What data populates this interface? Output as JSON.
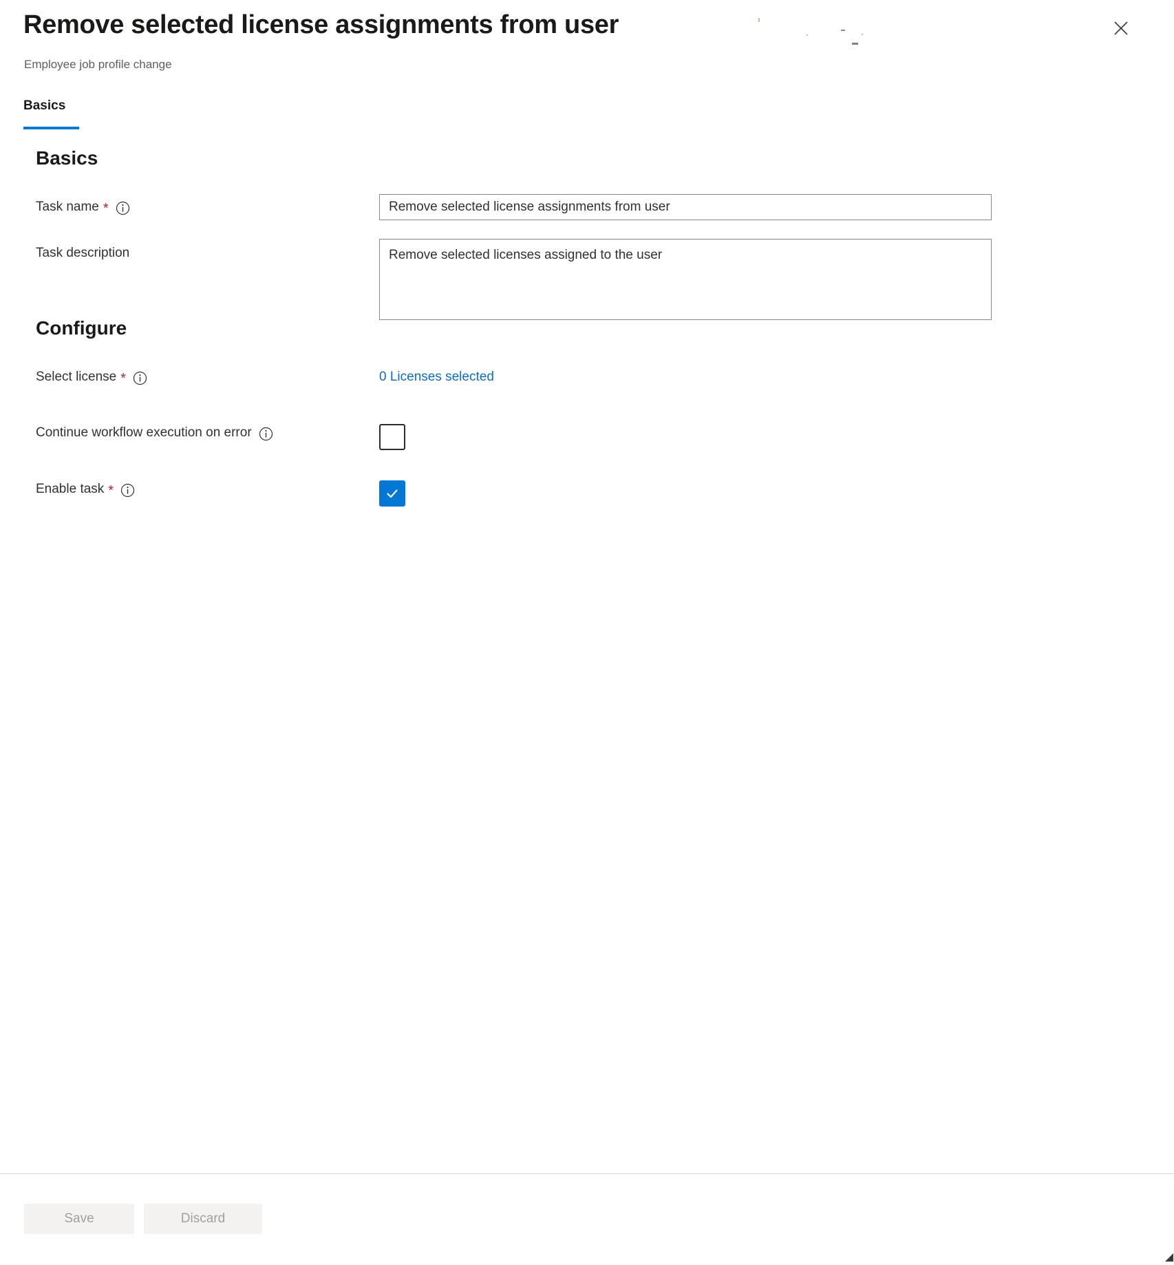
{
  "blade": {
    "title": "Remove selected license assignments from user",
    "subtitle": "Employee job profile change",
    "close_label": "Close",
    "close_icon": "close-icon"
  },
  "tabs": [
    {
      "label": "Basics",
      "selected": true
    }
  ],
  "sections": [
    {
      "heading": "Basics",
      "fields": [
        {
          "label": "Task name",
          "required": true,
          "info_icon": "info-icon",
          "control": "text",
          "value": "Remove selected license assignments from user",
          "placeholder": ""
        },
        {
          "label": "Task description",
          "required": false,
          "info_icon": null,
          "control": "textarea",
          "value": "Remove selected licenses assigned to the user",
          "placeholder": ""
        }
      ]
    },
    {
      "heading": "Configure",
      "fields": [
        {
          "label": "Select license",
          "required": true,
          "info_icon": "info-icon",
          "control": "link",
          "value": "0 Licenses selected"
        },
        {
          "label": "Continue workflow execution on error",
          "required": false,
          "info_icon": "info-icon",
          "control": "checkbox",
          "checked": false
        },
        {
          "label": "Enable task",
          "required": true,
          "info_icon": "info-icon",
          "control": "checkbox",
          "checked": true
        }
      ]
    }
  ],
  "footer": {
    "save_label": "Save",
    "discard_label": "Discard",
    "save_disabled": true,
    "discard_disabled": true
  },
  "colors": {
    "accent": "#0078d4",
    "link": "#0f6cbd",
    "required_star": "#a4262c",
    "title_text": "#1b1a19",
    "subtitle_text": "#605e5c",
    "input_border": "#8a8886",
    "footer_button_bg": "#f3f2f1",
    "footer_button_text": "#a19f9d",
    "divider": "#d6d6d6"
  }
}
